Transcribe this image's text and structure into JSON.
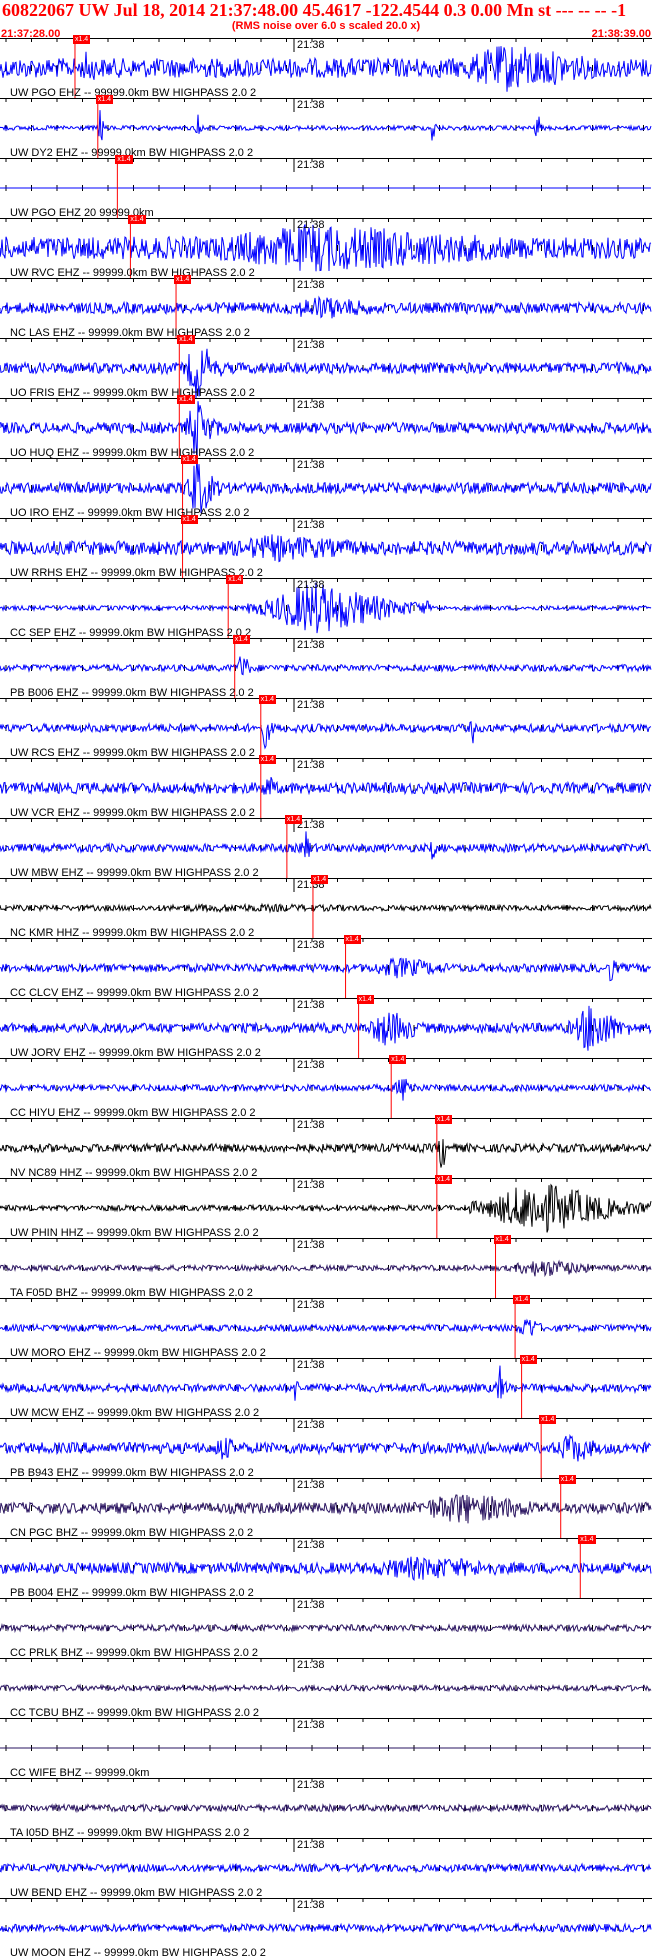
{
  "header": {
    "title": "60822067 UW Jul 18, 2014 21:37:48.00   45.4617 -122.4544  0.3 0.00 Mn st --- -- --   -1",
    "subtitle": "(RMS noise over 6.0 s scaled 20.0 x)",
    "start_time": "21:37:28.00",
    "end_time": "21:38:39.00"
  },
  "tick_time_label": "21:38",
  "pick_label": "x1.4",
  "colors": {
    "blue": "#0000ff",
    "black": "#000000",
    "purple": "#2a1460",
    "red": "#ff0000"
  },
  "traces": [
    {
      "label": "UW PGO EHZ -- 99999.0km BW  HIGHPASS  2.0  2",
      "color": "blue",
      "pick": 0.115,
      "amp": 0.35,
      "burst": [
        [
          0.12,
          0.04,
          0.7
        ],
        [
          0.66,
          0.34,
          0.9
        ]
      ]
    },
    {
      "label": "UW DY2 EHZ -- 99999.0km BW  HIGHPASS  2.0  2",
      "color": "blue",
      "pick": 0.15,
      "amp": 0.08,
      "burst": [
        [
          0.15,
          0.01,
          1.0
        ],
        [
          0.3,
          0.01,
          0.9
        ],
        [
          0.66,
          0.01,
          0.8
        ],
        [
          0.82,
          0.01,
          0.8
        ]
      ]
    },
    {
      "label": "UW PGO EHZ 20 99999.0km",
      "color": "blue",
      "pick": 0.18,
      "amp": 0.0,
      "burst": []
    },
    {
      "label": "UW RVC EHZ -- 99999.0km BW  HIGHPASS  2.0  2",
      "color": "blue",
      "pick": 0.2,
      "amp": 0.4,
      "burst": [
        [
          0.2,
          0.8,
          0.9
        ]
      ]
    },
    {
      "label": "NC LAS EHZ -- 99999.0km BW  HIGHPASS  2.0  2",
      "color": "blue",
      "pick": 0.27,
      "amp": 0.2,
      "burst": [
        [
          0.4,
          0.25,
          0.45
        ]
      ]
    },
    {
      "label": "UO FRIS EHZ -- 99999.0km BW  HIGHPASS  2.0  2",
      "color": "blue",
      "pick": 0.275,
      "amp": 0.2,
      "burst": [
        [
          0.28,
          0.06,
          1.2
        ]
      ]
    },
    {
      "label": "UO HUQ EHZ -- 99999.0km BW  HIGHPASS  2.0  2",
      "color": "blue",
      "pick": 0.275,
      "amp": 0.2,
      "burst": [
        [
          0.28,
          0.06,
          1.2
        ]
      ]
    },
    {
      "label": "UO IRO EHZ -- 99999.0km BW  HIGHPASS  2.0  2",
      "color": "blue",
      "pick": 0.28,
      "amp": 0.2,
      "burst": [
        [
          0.28,
          0.06,
          1.2
        ]
      ]
    },
    {
      "label": "UW RRHS EHZ -- 99999.0km BW  HIGHPASS  2.0  2",
      "color": "blue",
      "pick": 0.28,
      "amp": 0.25,
      "burst": [
        [
          0.28,
          0.4,
          0.5
        ]
      ]
    },
    {
      "label": "CC SEP EHZ -- 99999.0km BW  HIGHPASS  2.0  2",
      "color": "blue",
      "pick": 0.35,
      "amp": 0.08,
      "burst": [
        [
          0.38,
          0.28,
          1.0
        ]
      ]
    },
    {
      "label": "PB B006 EHZ -- 99999.0km BW  HIGHPASS  2.0  2",
      "color": "blue",
      "pick": 0.36,
      "amp": 0.12,
      "burst": [
        [
          0.36,
          0.03,
          0.6
        ]
      ]
    },
    {
      "label": "UW RCS EHZ -- 99999.0km BW  HIGHPASS  2.0  2",
      "color": "blue",
      "pick": 0.4,
      "amp": 0.15,
      "burst": [
        [
          0.4,
          0.02,
          0.8
        ],
        [
          0.72,
          0.01,
          0.8
        ]
      ]
    },
    {
      "label": "UW VCR EHZ -- 99999.0km BW  HIGHPASS  2.0  2",
      "color": "blue",
      "pick": 0.4,
      "amp": 0.2,
      "burst": [
        [
          0.4,
          0.03,
          0.6
        ]
      ]
    },
    {
      "label": "UW MBW EHZ -- 99999.0km BW  HIGHPASS  2.0  2",
      "color": "blue",
      "pick": 0.44,
      "amp": 0.15,
      "burst": [
        [
          0.46,
          0.02,
          0.8
        ],
        [
          0.66,
          0.01,
          0.8
        ]
      ]
    },
    {
      "label": "NC KMR HHZ -- 99999.0km BW  HIGHPASS  2.0  2",
      "color": "black",
      "pick": 0.48,
      "amp": 0.1,
      "burst": [
        [
          0.0,
          1.0,
          0.15
        ]
      ]
    },
    {
      "label": "CC CLCV EHZ -- 99999.0km BW  HIGHPASS  2.0  2",
      "color": "blue",
      "pick": 0.53,
      "amp": 0.15,
      "burst": [
        [
          0.54,
          0.2,
          0.4
        ],
        [
          0.93,
          0.02,
          0.6
        ]
      ]
    },
    {
      "label": "UW JORV EHZ -- 99999.0km BW  HIGHPASS  2.0  2",
      "color": "blue",
      "pick": 0.55,
      "amp": 0.18,
      "burst": [
        [
          0.55,
          0.12,
          0.7
        ],
        [
          0.87,
          0.1,
          1.0
        ]
      ]
    },
    {
      "label": "CC HIYU EHZ -- 99999.0km BW  HIGHPASS  2.0  2",
      "color": "blue",
      "pick": 0.6,
      "amp": 0.12,
      "burst": [
        [
          0.6,
          0.05,
          0.5
        ]
      ]
    },
    {
      "label": "NV NC89 HHZ -- 99999.0km BW  HIGHPASS  2.0  2",
      "color": "black",
      "pick": 0.67,
      "amp": 0.15,
      "burst": [
        [
          0.67,
          0.02,
          0.9
        ]
      ]
    },
    {
      "label": "UW PHIN HHZ -- 99999.0km BW  HIGHPASS  2.0  2",
      "color": "black",
      "pick": 0.67,
      "amp": 0.1,
      "burst": [
        [
          0.72,
          0.28,
          1.0
        ]
      ]
    },
    {
      "label": "TA F05D BHZ -- 99999.0km BW  HIGHPASS  2.0  2",
      "color": "purple",
      "pick": 0.76,
      "amp": 0.1,
      "burst": [
        [
          0.76,
          0.2,
          0.35
        ]
      ]
    },
    {
      "label": "UW MORO EHZ -- 99999.0km BW  HIGHPASS  2.0  2",
      "color": "blue",
      "pick": 0.79,
      "amp": 0.12,
      "burst": [
        [
          0.79,
          0.05,
          0.5
        ]
      ]
    },
    {
      "label": "UW MCW EHZ -- 99999.0km BW  HIGHPASS  2.0  2",
      "color": "blue",
      "pick": 0.8,
      "amp": 0.15,
      "burst": [
        [
          0.45,
          0.01,
          0.7
        ],
        [
          0.76,
          0.02,
          0.9
        ]
      ]
    },
    {
      "label": "PB B943 EHZ -- 99999.0km BW  HIGHPASS  2.0  2",
      "color": "blue",
      "pick": 0.83,
      "amp": 0.2,
      "burst": [
        [
          0.32,
          0.06,
          0.5
        ],
        [
          0.84,
          0.1,
          0.6
        ]
      ]
    },
    {
      "label": "CN PGC BHZ -- 99999.0km BW  HIGHPASS  2.0  2",
      "color": "purple",
      "pick": 0.86,
      "amp": 0.2,
      "burst": [
        [
          0.6,
          0.3,
          0.6
        ]
      ]
    },
    {
      "label": "PB B004 EHZ -- 99999.0km BW  HIGHPASS  2.0  2",
      "color": "blue",
      "pick": 0.89,
      "amp": 0.2,
      "burst": [
        [
          0.5,
          0.4,
          0.45
        ]
      ]
    },
    {
      "label": "CC PRLK BHZ -- 99999.0km BW  HIGHPASS  2.0  2",
      "color": "purple",
      "pick": null,
      "amp": 0.12,
      "burst": []
    },
    {
      "label": "CC TCBU BHZ -- 99999.0km BW  HIGHPASS  2.0  2",
      "color": "purple",
      "pick": null,
      "amp": 0.1,
      "burst": []
    },
    {
      "label": "CC WIFE BHZ -- 99999.0km",
      "color": "purple",
      "pick": null,
      "amp": 0.0,
      "burst": []
    },
    {
      "label": "TA I05D BHZ -- 99999.0km BW  HIGHPASS  2.0  2",
      "color": "purple",
      "pick": null,
      "amp": 0.12,
      "burst": []
    },
    {
      "label": "UW BEND EHZ -- 99999.0km BW  HIGHPASS  2.0  2",
      "color": "blue",
      "pick": null,
      "amp": 0.14,
      "burst": []
    },
    {
      "label": "UW MOON EHZ -- 99999.0km BW  HIGHPASS  2.0  2",
      "color": "blue",
      "pick": null,
      "amp": 0.14,
      "burst": []
    }
  ]
}
